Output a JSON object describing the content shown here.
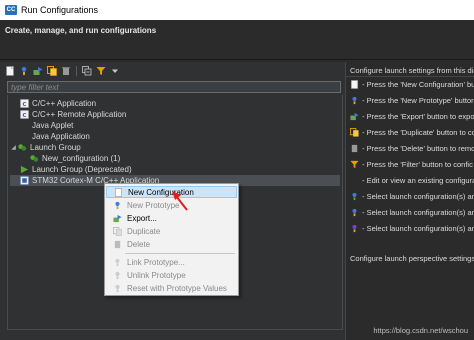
{
  "window": {
    "app_icon_text": "CC",
    "title": "Run Configurations"
  },
  "header": {
    "subtitle": "Create, manage, and run configurations"
  },
  "toolbar": {
    "icons": [
      "new-config-icon",
      "new-prototype-icon",
      "export-icon",
      "duplicate-icon",
      "delete-icon",
      "collapse-all-icon",
      "filter-icon",
      "dropdown-arrow-icon"
    ]
  },
  "filter": {
    "placeholder": "type filter text",
    "value": ""
  },
  "tree": {
    "items": [
      {
        "label": "C/C++ Application",
        "icon": "c-app-icon",
        "level": 1
      },
      {
        "label": "C/C++ Remote Application",
        "icon": "c-remote-icon",
        "level": 1
      },
      {
        "label": "Java Applet",
        "icon": "",
        "level": 1
      },
      {
        "label": "Java Application",
        "icon": "",
        "level": 1
      },
      {
        "label": "Launch Group",
        "icon": "launch-group-icon",
        "level": 1,
        "expanded": true
      },
      {
        "label": "New_configuration (1)",
        "icon": "launch-group-icon",
        "level": 2
      },
      {
        "label": "Launch Group (Deprecated)",
        "icon": "launch-group-deprecated-icon",
        "level": 1
      },
      {
        "label": "STM32 Cortex-M C/C++ Application",
        "icon": "stm32-icon",
        "level": 1,
        "selected": true
      }
    ]
  },
  "context_menu": {
    "items": [
      {
        "label": "New Configuration",
        "icon": "new-config-icon",
        "enabled": true,
        "highlighted": true
      },
      {
        "label": "New Prototype",
        "icon": "new-prototype-icon",
        "enabled": false
      },
      {
        "label": "Export...",
        "icon": "export-icon",
        "enabled": true
      },
      {
        "label": "Duplicate",
        "icon": "duplicate-icon",
        "enabled": false
      },
      {
        "label": "Delete",
        "icon": "delete-icon",
        "enabled": false
      },
      {
        "label": "Link Prototype...",
        "icon": "link-icon",
        "enabled": false
      },
      {
        "label": "Unlink Prototype",
        "icon": "unlink-icon",
        "enabled": false
      },
      {
        "label": "Reset with Prototype Values",
        "icon": "reset-icon",
        "enabled": false
      }
    ]
  },
  "right_panel": {
    "heading": "Configure launch settings from this dia",
    "lines": [
      {
        "icon": "new-config-icon",
        "text": "- Press the 'New Configuration' butto"
      },
      {
        "icon": "new-prototype-icon",
        "text": "- Press the 'New Prototype' button"
      },
      {
        "icon": "export-icon",
        "text": "- Press the 'Export' button to expo"
      },
      {
        "icon": "duplicate-icon",
        "text": "- Press the 'Duplicate' button to cc"
      },
      {
        "icon": "delete-icon",
        "text": "- Press the 'Delete' button to remo"
      },
      {
        "icon": "filter-icon",
        "text": "- Press the 'Filter' button to confic"
      },
      {
        "icon": "",
        "text": "- Edit or view an existing configura"
      },
      {
        "icon": "debug-icon",
        "text": "- Select launch configuration(s) an"
      },
      {
        "icon": "debug-icon",
        "text": "- Select launch configuration(s) an"
      },
      {
        "icon": "debug-icon",
        "text": "- Select launch configuration(s) an"
      }
    ],
    "perspective_text": "Configure launch perspective settings",
    "watermark": "https://blog.csdn.net/wschou"
  },
  "colors": {
    "highlight": "#cce4f7",
    "selection": "#4b4f53",
    "accent": "#2d6fb5",
    "arrow": "#e02020"
  }
}
